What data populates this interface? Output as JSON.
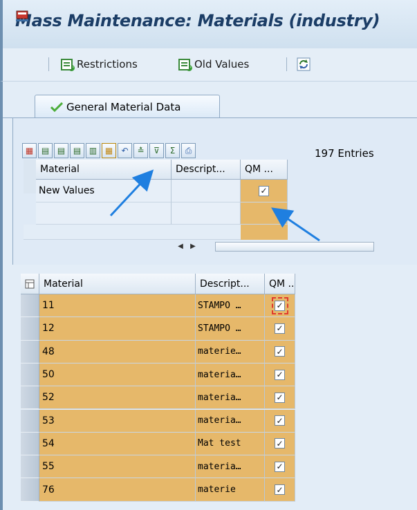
{
  "window": {
    "title": "Mass Maintenance: Materials (industry)"
  },
  "toolbar": {
    "restrictions_label": "Restrictions",
    "old_values_label": "Old Values"
  },
  "tab": {
    "label": "General Material Data"
  },
  "alv_toolbar": {
    "buttons": [
      "select-all-icon",
      "block-icon",
      "deselect-icon",
      "select-block-icon",
      "filter-select-icon",
      "copy-values-icon",
      "undo-icon",
      "sort-icon",
      "filter-icon",
      "sum-icon",
      "print-icon"
    ],
    "entries_text": "197 Entries"
  },
  "new_values_grid": {
    "headers": [
      "Material",
      "Descript...",
      "QM ..."
    ],
    "rows": [
      {
        "material": "New Values",
        "description": "",
        "qm_checked": true
      }
    ]
  },
  "materials_table": {
    "headers": [
      "Material",
      "Descript...",
      "QM ..."
    ],
    "rows": [
      {
        "material": "11",
        "description": "STAMPO …",
        "qm_checked": true
      },
      {
        "material": "12",
        "description": "STAMPO …",
        "qm_checked": true
      },
      {
        "material": "48",
        "description": "materie…",
        "qm_checked": true
      },
      {
        "material": "50",
        "description": "materia…",
        "qm_checked": true
      },
      {
        "material": "52",
        "description": "materia…",
        "qm_checked": true
      },
      {
        "material": "53",
        "description": "materia…",
        "qm_checked": true
      },
      {
        "material": "54",
        "description": "Mat test",
        "qm_checked": true
      },
      {
        "material": "55",
        "description": "materia…",
        "qm_checked": true
      },
      {
        "material": "76",
        "description": "materie",
        "qm_checked": true
      }
    ]
  },
  "colors": {
    "highlight": "#e6b86a",
    "accent_arrow": "#1f7fe0",
    "focus_border": "#e03a2e"
  }
}
